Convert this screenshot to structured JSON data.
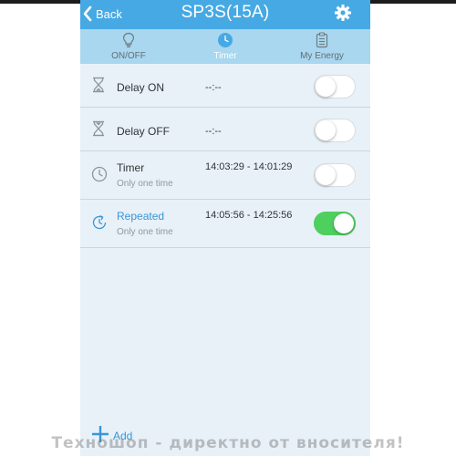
{
  "header": {
    "back_label": "Back",
    "title": "SP3S(15A)"
  },
  "tabs": [
    {
      "label": "ON/OFF",
      "icon": "bulb-icon",
      "active": false
    },
    {
      "label": "Timer",
      "icon": "clock-icon",
      "active": true
    },
    {
      "label": "My Energy",
      "icon": "clipboard-icon",
      "active": false
    }
  ],
  "timers": [
    {
      "name": "Delay ON",
      "time": "--:--",
      "subtitle": "",
      "enabled": false,
      "icon": "hourglass-icon"
    },
    {
      "name": "Delay OFF",
      "time": "--:--",
      "subtitle": "",
      "enabled": false,
      "icon": "hourglass-icon"
    },
    {
      "name": "Timer",
      "time": "14:03:29 - 14:01:29",
      "subtitle": "Only one time",
      "enabled": false,
      "icon": "clock-icon"
    },
    {
      "name": "Repeated",
      "time": "14:05:56 - 14:25:56",
      "subtitle": "Only one time",
      "enabled": true,
      "icon": "repeat-clock-icon"
    }
  ],
  "add_label": "Add",
  "watermark": "Техношоп - директно от вносителя!",
  "colors": {
    "header": "#46a9e4",
    "tabbar": "#a8d7ef",
    "background": "#e8f1f8",
    "toggle_on": "#4fcf5e",
    "accent": "#3a95d6"
  }
}
